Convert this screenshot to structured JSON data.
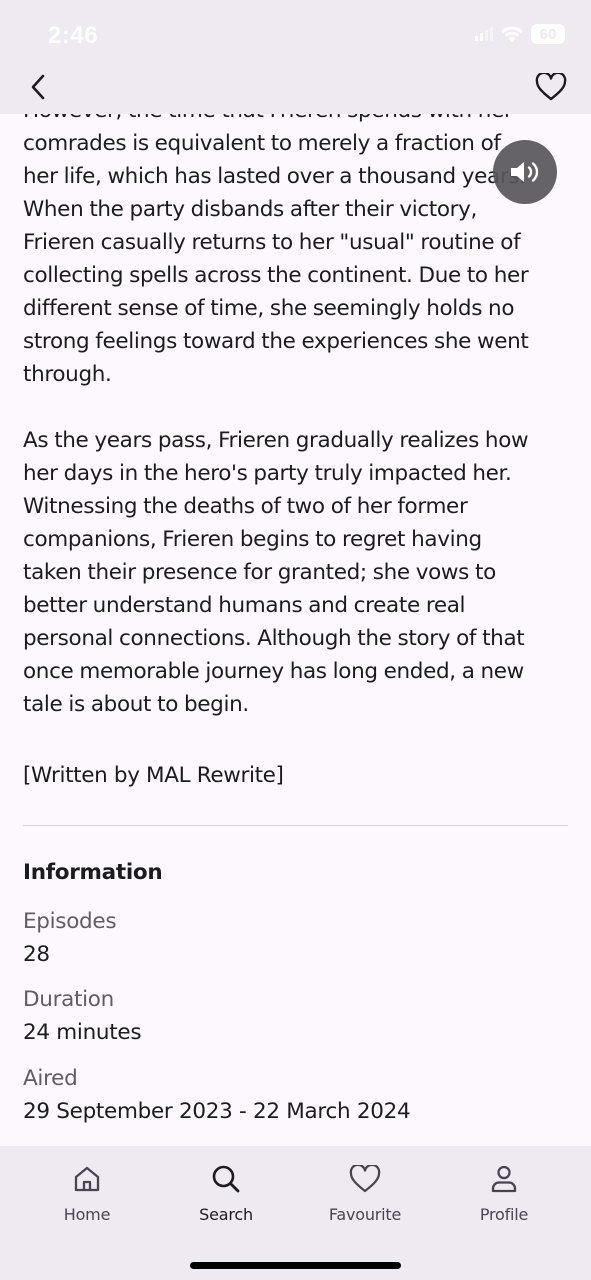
{
  "status": {
    "time": "2:46",
    "battery": "60"
  },
  "synopsis": {
    "paragraphs": "However, the time that Frieren spends with her\ncomrades is equivalent to merely a fraction of\nher life, which has lasted over a thousand years.\nWhen the party disbands after their victory,\nFrieren casually returns to her \"usual\" routine of\ncollecting spells across the continent. Due to her\ndifferent sense of time, she seemingly holds no\nstrong feelings toward the experiences she went\nthrough.\n\nAs the years pass, Frieren gradually realizes how\nher days in the hero's party truly impacted her.\nWitnessing the deaths of two of her former\ncompanions, Frieren begins to regret having\ntaken their presence for granted; she vows to\nbetter understand humans and create real\npersonal connections. Although the story of that\nonce memorable journey has long ended, a new\ntale is about to begin.",
    "credit": "[Written by MAL Rewrite]"
  },
  "information": {
    "heading": "Information",
    "items": [
      {
        "label": "Episodes",
        "value": "28"
      },
      {
        "label": "Duration",
        "value": "24 minutes"
      },
      {
        "label": "Aired",
        "value": "29 September 2023 - 22 March 2024"
      }
    ]
  },
  "nav": {
    "items": [
      {
        "label": "Home",
        "icon": "home-icon"
      },
      {
        "label": "Search",
        "icon": "search-icon",
        "active": true
      },
      {
        "label": "Favourite",
        "icon": "heart-icon"
      },
      {
        "label": "Profile",
        "icon": "person-icon"
      }
    ]
  },
  "colors": {
    "surface": "#fcf8fd",
    "bar": "#efe9f2",
    "text": "#1c1b1f",
    "muted": "#5f5c63"
  }
}
